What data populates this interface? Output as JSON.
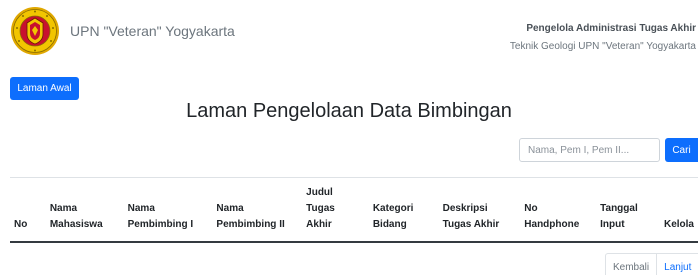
{
  "header": {
    "logo_icon": "upn-veteran-seal",
    "university_name": "UPN \"Veteran\" Yogyakarta",
    "admin_title": "Pengelola Administrasi Tugas Akhir",
    "admin_subtitle": "Teknik Geologi UPN \"Veteran\" Yogyakarta"
  },
  "nav": {
    "home_label": "Laman Awal"
  },
  "page": {
    "title": "Laman Pengelolaan Data Bimbingan"
  },
  "search": {
    "placeholder": "Nama, Pem I, Pem II...",
    "value": "",
    "button_label": "Cari"
  },
  "table": {
    "headers": [
      {
        "line1": "",
        "line2": "",
        "line3": "No"
      },
      {
        "line1": "",
        "line2": "Nama",
        "line3": "Mahasiswa"
      },
      {
        "line1": "",
        "line2": "Nama",
        "line3": "Pembimbing I"
      },
      {
        "line1": "",
        "line2": "Nama",
        "line3": "Pembimbing II"
      },
      {
        "line1": "Judul",
        "line2": "Tugas",
        "line3": "Akhir"
      },
      {
        "line1": "",
        "line2": "Kategori",
        "line3": "Bidang"
      },
      {
        "line1": "",
        "line2": "Deskripsi",
        "line3": "Tugas Akhir"
      },
      {
        "line1": "",
        "line2": "No",
        "line3": "Handphone"
      },
      {
        "line1": "",
        "line2": "Tanggal",
        "line3": "Input"
      },
      {
        "line1": "",
        "line2": "",
        "line3": "Kelola"
      }
    ],
    "rows": []
  },
  "pagination": {
    "prev_label": "Kembali",
    "next_label": "Lanjut"
  },
  "colors": {
    "primary": "#0d6efd",
    "logo_yellow": "#f2c500",
    "logo_red": "#c8102e"
  }
}
